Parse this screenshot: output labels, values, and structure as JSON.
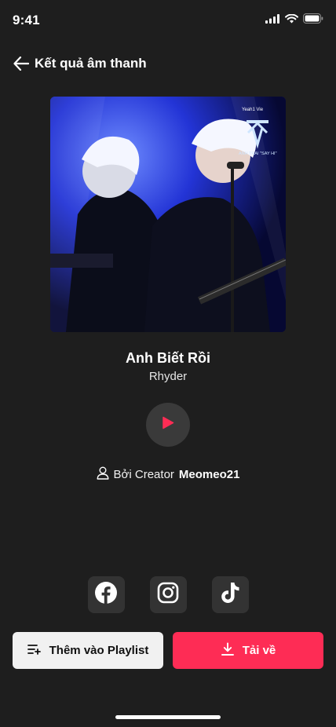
{
  "status_bar": {
    "time": "9:41"
  },
  "header": {
    "title": "Kết quả âm thanh",
    "back_icon": "arrow-left-icon"
  },
  "cover": {
    "logo_text": "ANH TRAI \"SAY HI\"",
    "brand_text": "Yeah1  Vie"
  },
  "song": {
    "title": "Anh Biết Rồi",
    "artist": "Rhyder"
  },
  "creator": {
    "prefix": "Bởi Creator",
    "name": "Meomeo21",
    "icon": "user-icon"
  },
  "socials": [
    {
      "name": "facebook-icon"
    },
    {
      "name": "instagram-icon"
    },
    {
      "name": "tiktok-icon"
    }
  ],
  "actions": {
    "playlist_label": "Thêm vào Playlist",
    "download_label": "Tải về"
  },
  "colors": {
    "accent": "#fe2c55",
    "background": "#1e1e1e"
  }
}
